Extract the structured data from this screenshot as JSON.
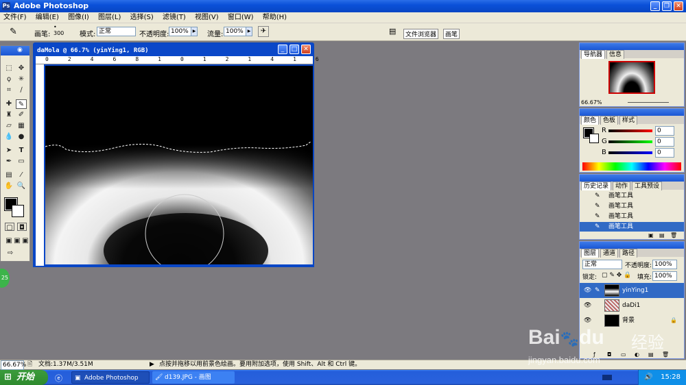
{
  "app": {
    "title": "Adobe Photoshop",
    "menu": [
      "文件(F)",
      "编辑(E)",
      "图像(I)",
      "图层(L)",
      "选择(S)",
      "滤镜(T)",
      "视图(V)",
      "窗口(W)",
      "帮助(H)"
    ]
  },
  "options": {
    "brush_label": "画笔:",
    "brush_size": "300",
    "mode_label": "模式:",
    "mode_value": "正常",
    "opacity_label": "不透明度:",
    "opacity_value": "100%",
    "flow_label": "流量:",
    "flow_value": "100%",
    "tab_filebrowser": "文件浏览器",
    "tab_brushes": "画笔"
  },
  "document": {
    "title": "daMola @ 66.7% (yinYing1, RGB)",
    "ruler_ticks": [
      "0",
      "2",
      "4",
      "6",
      "8",
      "10",
      "12",
      "14",
      "16",
      "18",
      "2"
    ]
  },
  "navigator": {
    "tabs": [
      "导航器",
      "信息"
    ],
    "zoom": "66.67%"
  },
  "color": {
    "tabs": [
      "颜色",
      "色板",
      "样式"
    ],
    "channels": [
      {
        "label": "R",
        "value": "0"
      },
      {
        "label": "G",
        "value": "0"
      },
      {
        "label": "B",
        "value": "0"
      }
    ]
  },
  "history": {
    "tabs": [
      "历史记录",
      "动作",
      "工具预设"
    ],
    "items": [
      "画笔工具",
      "画笔工具",
      "画笔工具",
      "画笔工具"
    ]
  },
  "layers": {
    "tabs": [
      "图层",
      "通道",
      "路径"
    ],
    "blend_mode": "正常",
    "opacity_label": "不透明度:",
    "opacity_value": "100%",
    "lock_label": "锁定:",
    "fill_label": "填充:",
    "fill_value": "100%",
    "items": [
      {
        "name": "yinYing1",
        "selected": true
      },
      {
        "name": "daDi1",
        "selected": false
      },
      {
        "name": "背景",
        "selected": false
      }
    ]
  },
  "status": {
    "zoom": "66.67%",
    "doc_info": "文档:1.37M/3.51M",
    "hint": "点按并拖移以用前景色绘画。要用附加选项，使用 Shift、Alt 和 Ctrl 键。"
  },
  "taskbar": {
    "start": "开始",
    "items": [
      "Adobe Photoshop",
      "d139.JPG - 画图"
    ],
    "time": "15:28"
  },
  "watermark": {
    "brand": "Bai",
    "brand2": "du",
    "cn": "经验",
    "url": "jingyan.baidu.com"
  },
  "badge": "25"
}
